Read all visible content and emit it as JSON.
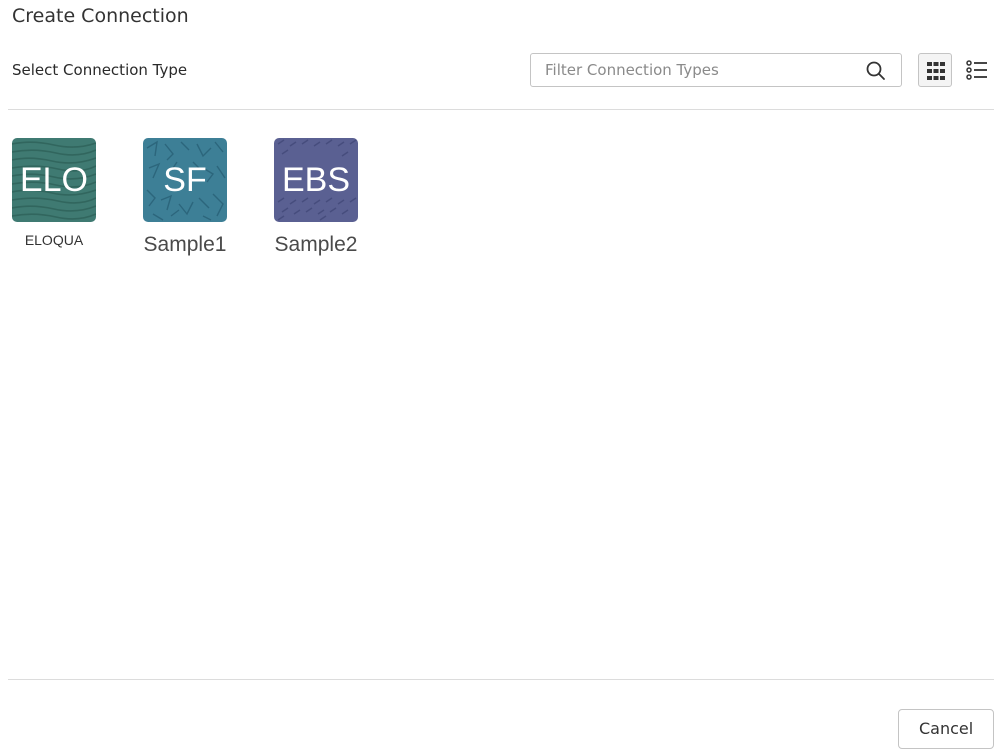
{
  "dialog": {
    "title": "Create Connection",
    "section_label": "Select Connection Type"
  },
  "search": {
    "placeholder": "Filter Connection Types",
    "value": "",
    "icon": "search-icon"
  },
  "view_toggle": {
    "grid_icon": "grid-view-icon",
    "list_icon": "list-view-icon",
    "selected": "grid"
  },
  "connection_types": [
    {
      "abbr": "ELO",
      "name": "ELOQUA",
      "color": "#3f7a72"
    },
    {
      "abbr": "SF",
      "name": "Sample1",
      "color": "#3d7f96"
    },
    {
      "abbr": "EBS",
      "name": "Sample2",
      "color": "#5a6092"
    }
  ],
  "footer": {
    "cancel_label": "Cancel"
  }
}
